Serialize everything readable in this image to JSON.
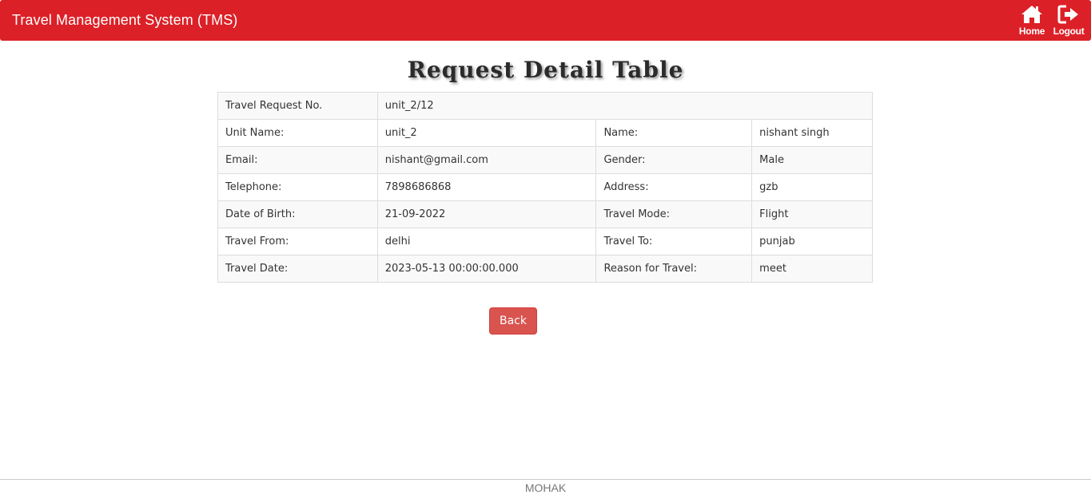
{
  "header": {
    "title": "Travel Management System (TMS)",
    "home_label": "Home",
    "logout_label": "Logout",
    "bg_color": "#dc2027"
  },
  "page": {
    "title": "Request Detail Table"
  },
  "request": {
    "request_no_label": "Travel Request No.",
    "request_no_value": "unit_2/12",
    "rows": [
      {
        "l1": "Unit Name:",
        "v1": "unit_2",
        "l2": "Name:",
        "v2": "nishant singh"
      },
      {
        "l1": "Email:",
        "v1": "nishant@gmail.com",
        "l2": "Gender:",
        "v2": "Male"
      },
      {
        "l1": "Telephone:",
        "v1": "7898686868",
        "l2": "Address:",
        "v2": "gzb"
      },
      {
        "l1": "Date of Birth:",
        "v1": "21-09-2022",
        "l2": "Travel Mode:",
        "v2": "Flight"
      },
      {
        "l1": "Travel From:",
        "v1": "delhi",
        "l2": "Travel To:",
        "v2": "punjab"
      },
      {
        "l1": "Travel Date:",
        "v1": "2023-05-13 00:00:00.000",
        "l2": "Reason for Travel:",
        "v2": "meet"
      }
    ]
  },
  "actions": {
    "back_label": "Back",
    "back_color": "#d9534f"
  },
  "footer": {
    "text": "MOHAK"
  }
}
